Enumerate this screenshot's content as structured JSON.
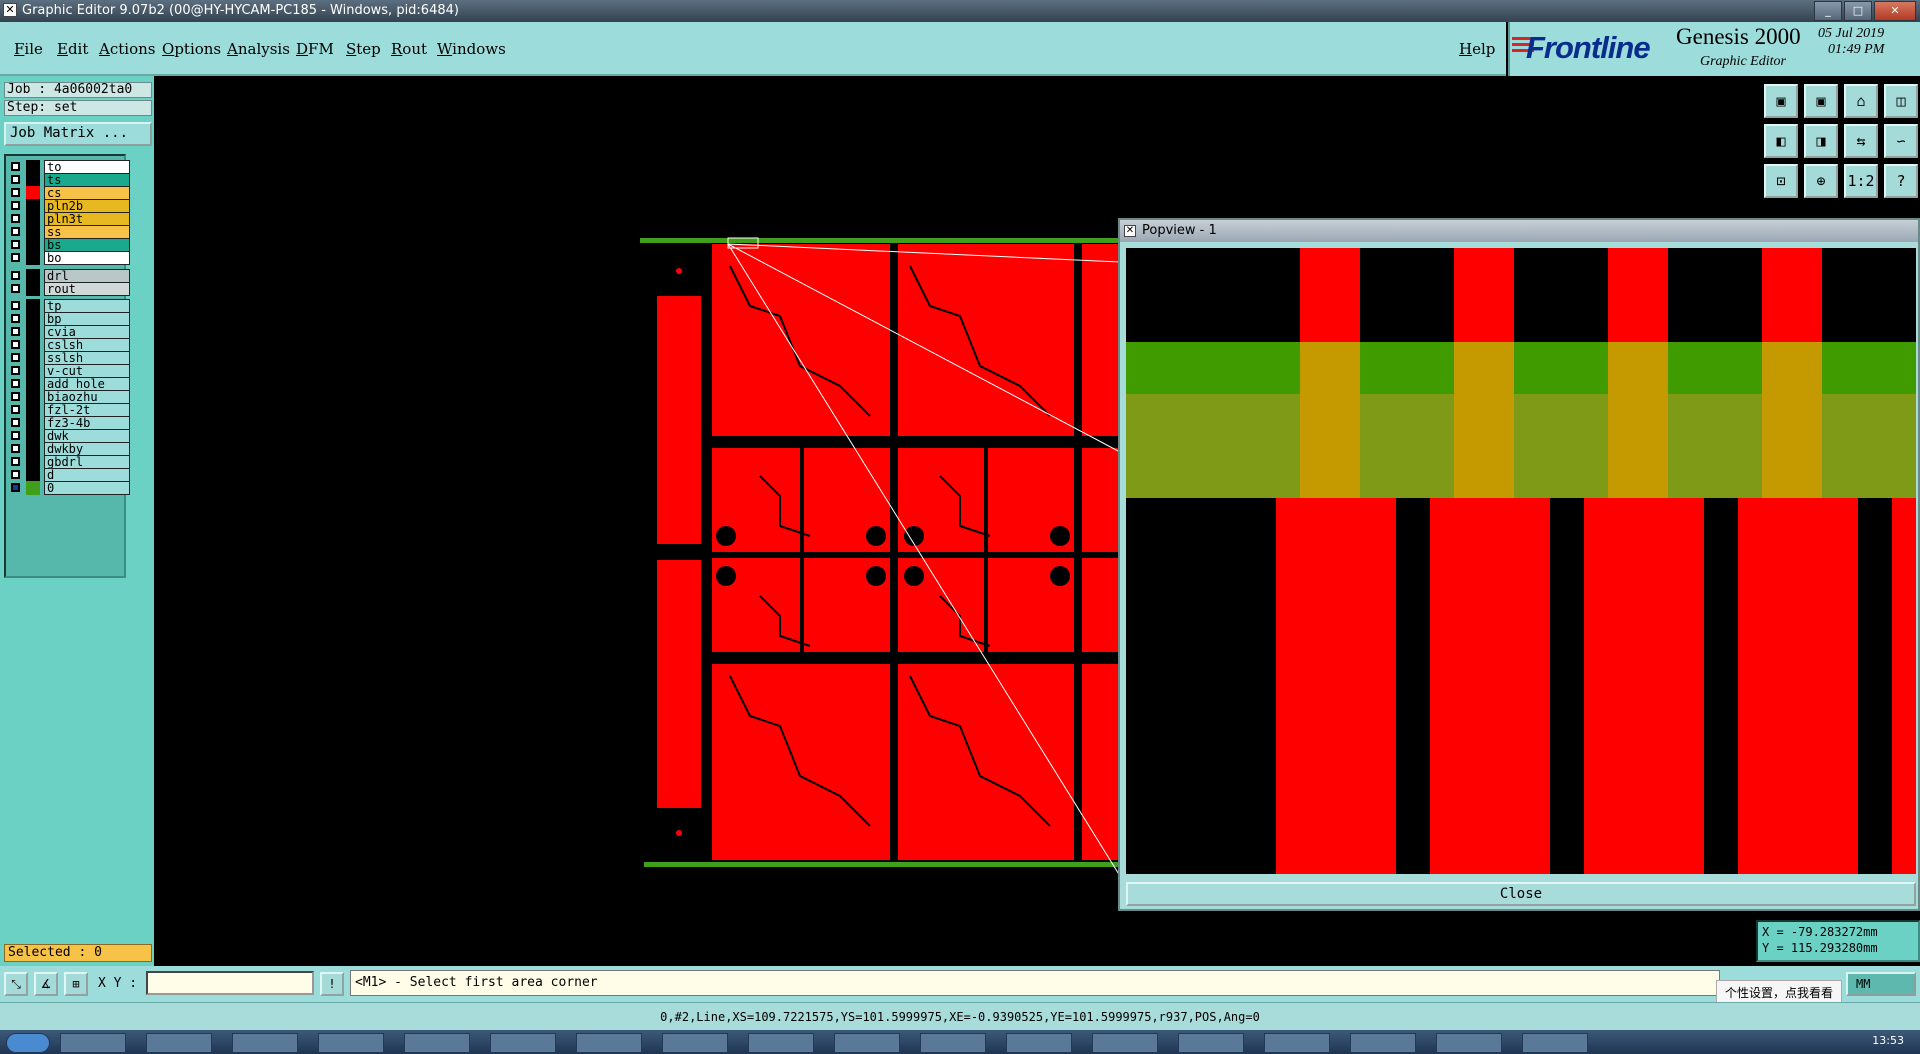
{
  "window": {
    "title": "Graphic Editor 9.07b2 (00@HY-HYCAM-PC185 - Windows, pid:6484)"
  },
  "menu": {
    "items": [
      "File",
      "Edit",
      "Actions",
      "Options",
      "Analysis",
      "DFM",
      "Step",
      "Rout",
      "Windows"
    ],
    "help": "Help"
  },
  "brand": {
    "logo": "Frontline",
    "product": "Genesis 2000",
    "subtitle": "Graphic Editor",
    "date": "05 Jul 2019",
    "time": "01:49 PM"
  },
  "job": {
    "job_label": "Job : 4a06002ta0",
    "step_label": "Step: set",
    "job_matrix_button": "Job Matrix ..."
  },
  "layers": [
    {
      "name": "to",
      "color": "#ffffff"
    },
    {
      "name": "ts",
      "color": "#1aa98c"
    },
    {
      "name": "cs",
      "color": "#f7c248"
    },
    {
      "name": "pln2b",
      "color": "#e8b820"
    },
    {
      "name": "pln3t",
      "color": "#e8b820"
    },
    {
      "name": "ss",
      "color": "#f7c248"
    },
    {
      "name": "bs",
      "color": "#1aa98c"
    },
    {
      "name": "bo",
      "color": "#ffffff"
    },
    {
      "name": "drl",
      "color": "#b8c8c8"
    },
    {
      "name": "rout",
      "color": "#d0d8d8"
    },
    {
      "name": "tp",
      "color": "#9cdcda"
    },
    {
      "name": "bp",
      "color": "#9cdcda"
    },
    {
      "name": "cvia",
      "color": "#9cdcda"
    },
    {
      "name": "cslsh",
      "color": "#9cdcda"
    },
    {
      "name": "sslsh",
      "color": "#9cdcda"
    },
    {
      "name": "v-cut",
      "color": "#9cdcda"
    },
    {
      "name": "add_hole",
      "color": "#9cdcda"
    },
    {
      "name": "biaozhu",
      "color": "#9cdcda"
    },
    {
      "name": "fzl-2t",
      "color": "#9cdcda"
    },
    {
      "name": "fz3-4b",
      "color": "#9cdcda"
    },
    {
      "name": "dwk",
      "color": "#9cdcda"
    },
    {
      "name": "dwkby",
      "color": "#9cdcda"
    },
    {
      "name": "gbdrl",
      "color": "#9cdcda"
    },
    {
      "name": "d",
      "color": "#9cdcda"
    },
    {
      "name": "0",
      "color": "#9cdcda"
    }
  ],
  "selected": "Selected : 0",
  "tools": [
    {
      "icon": "panel-up-icon",
      "glyph": "▣"
    },
    {
      "icon": "panel-down-icon",
      "glyph": "▣"
    },
    {
      "icon": "home-icon",
      "glyph": "⌂"
    },
    {
      "icon": "split-window-icon",
      "glyph": "◫"
    },
    {
      "icon": "pan-left-icon",
      "glyph": "◧"
    },
    {
      "icon": "pan-right-icon",
      "glyph": "◨"
    },
    {
      "icon": "mirror-icon",
      "glyph": "⇆"
    },
    {
      "icon": "redraw-icon",
      "glyph": "∽"
    },
    {
      "icon": "zoom-fit-icon",
      "glyph": "⊡"
    },
    {
      "icon": "zoom-window-icon",
      "glyph": "⊕"
    },
    {
      "icon": "scale-1to2-icon",
      "glyph": "1:2"
    },
    {
      "icon": "help-icon",
      "glyph": "?"
    }
  ],
  "popview": {
    "title": "Popview - 1",
    "close": "Close"
  },
  "coords": {
    "x": "X = -79.283272mm",
    "y": "Y = 115.293280mm"
  },
  "command": {
    "xy_label": "X Y :",
    "xy_value": "",
    "prompt": "<M1> - Select first area corner",
    "units": "MM"
  },
  "status_line": "0,#2,Line,XS=109.7221575,YS=101.5999975,XE=-0.9390525,YE=101.5999975,r937,POS,Ang=0",
  "tooltip": "个性设置，点我看看",
  "clock": "13:53"
}
